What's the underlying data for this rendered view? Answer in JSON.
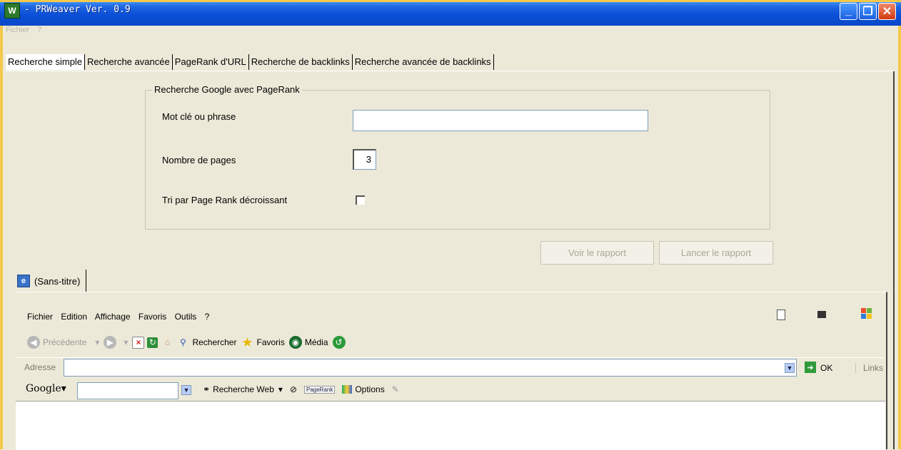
{
  "window": {
    "title": "- PRWeaver Ver. 0.9",
    "icon": "app-icon",
    "controls": [
      "minimize",
      "maximize",
      "close"
    ]
  },
  "menubar": [
    "Fichier",
    "?"
  ],
  "tabs": [
    {
      "label": "Recherche simple",
      "active": true
    },
    {
      "label": "Recherche avancée",
      "active": false
    },
    {
      "label": "PageRank d'URL",
      "active": false
    },
    {
      "label": "Recherche de backlinks",
      "active": false
    },
    {
      "label": "Recherche avancée de backlinks",
      "active": false
    }
  ],
  "form": {
    "group_title": "Recherche Google avec PageRank",
    "keyword_label": "Mot clé ou phrase",
    "keyword_value": "",
    "pages_label": "Nombre de pages",
    "pages_value": "3",
    "sort_label": "Tri par Page Rank décroissant",
    "sort_checked": false
  },
  "buttons": {
    "voir": "Voir le rapport",
    "lancer": "Lancer le rapport"
  },
  "browser": {
    "doc_tab": "(Sans-titre)",
    "menu": [
      "Fichier",
      "Edition",
      "Affichage",
      "Favoris",
      "Outils",
      "?"
    ],
    "toolbar": {
      "back": "Précédente",
      "search": "Rechercher",
      "favorites": "Favoris",
      "media": "Média"
    },
    "address": {
      "label": "Adresse",
      "value": "",
      "go": "OK",
      "links": "Links"
    },
    "google": {
      "logo": "Google▾",
      "search_web": "Recherche Web",
      "pagerank": "PageRank",
      "options": "Options"
    }
  },
  "colors": {
    "face": "#ECE9D8",
    "titlebar": "#0B4FD6",
    "frame": "#F4C84A"
  }
}
